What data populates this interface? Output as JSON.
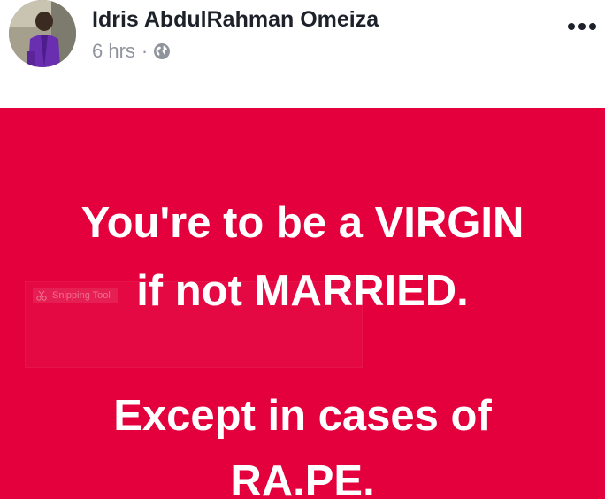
{
  "post": {
    "author": "Idris AbdulRahman Omeiza",
    "time": "6 hrs",
    "separator": "·",
    "privacy_icon": "globe-icon",
    "menu_icon": "more-options-icon"
  },
  "content": {
    "background_color": "#e3003c",
    "text_color": "#ffffff",
    "lines": [
      "You're to be a VIRGIN",
      "if not MARRIED.",
      "Except in cases of",
      "RA.PE."
    ]
  },
  "overlay": {
    "label": "Snipping Tool"
  }
}
